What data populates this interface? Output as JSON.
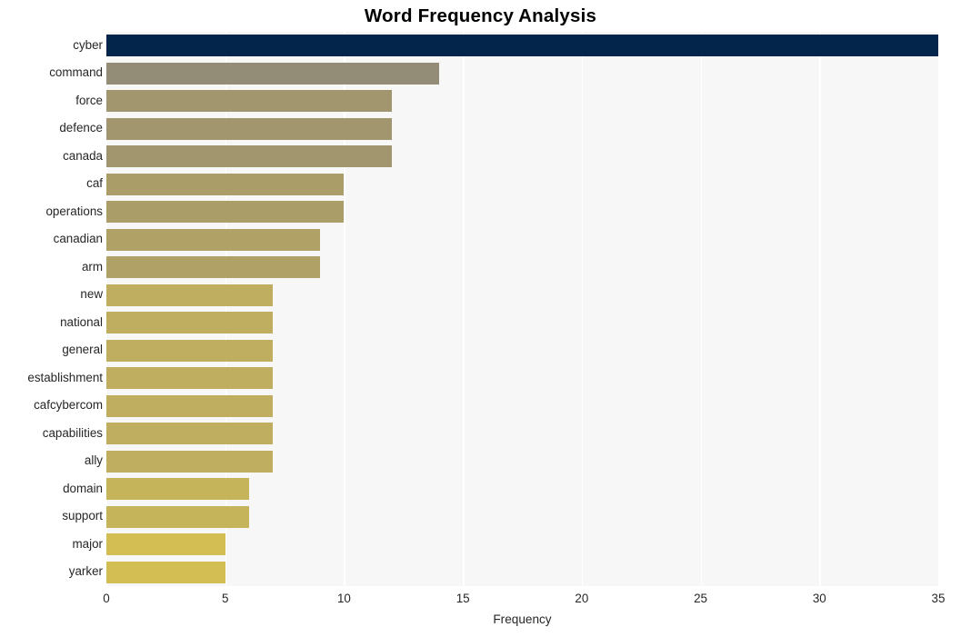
{
  "chart_data": {
    "type": "bar",
    "orientation": "horizontal",
    "title": "Word Frequency Analysis",
    "xlabel": "Frequency",
    "ylabel": "",
    "xlim": [
      0,
      35
    ],
    "xticks": [
      0,
      5,
      10,
      15,
      20,
      25,
      30,
      35
    ],
    "xtick_labels": [
      "0",
      "5",
      "10",
      "15",
      "20",
      "25",
      "30",
      "35"
    ],
    "grid": "vertical-white-on-gray",
    "legend": null,
    "categories": [
      "cyber",
      "command",
      "force",
      "defence",
      "canada",
      "caf",
      "operations",
      "canadian",
      "arm",
      "new",
      "national",
      "general",
      "establishment",
      "cafcybercom",
      "capabilities",
      "ally",
      "domain",
      "support",
      "major",
      "yarker"
    ],
    "values": [
      35,
      14,
      12,
      12,
      12,
      10,
      10,
      9,
      9,
      7,
      7,
      7,
      7,
      7,
      7,
      7,
      6,
      6,
      5,
      5
    ],
    "bar_colors": [
      "#03254c",
      "#938c76",
      "#a2966f",
      "#a2966f",
      "#a2966f",
      "#ab9d68",
      "#ab9d68",
      "#b0a166",
      "#b0a166",
      "#bfae5f",
      "#bfae5f",
      "#bfae5f",
      "#bfae5f",
      "#bfae5f",
      "#bfae5f",
      "#bfae5f",
      "#c6b45b",
      "#c6b45b",
      "#d3be54",
      "#d3be54"
    ],
    "plot_background": "#f7f7f7",
    "grid_color": "#ffffff",
    "figure_background": "#ffffff",
    "text_color": "#262626"
  }
}
